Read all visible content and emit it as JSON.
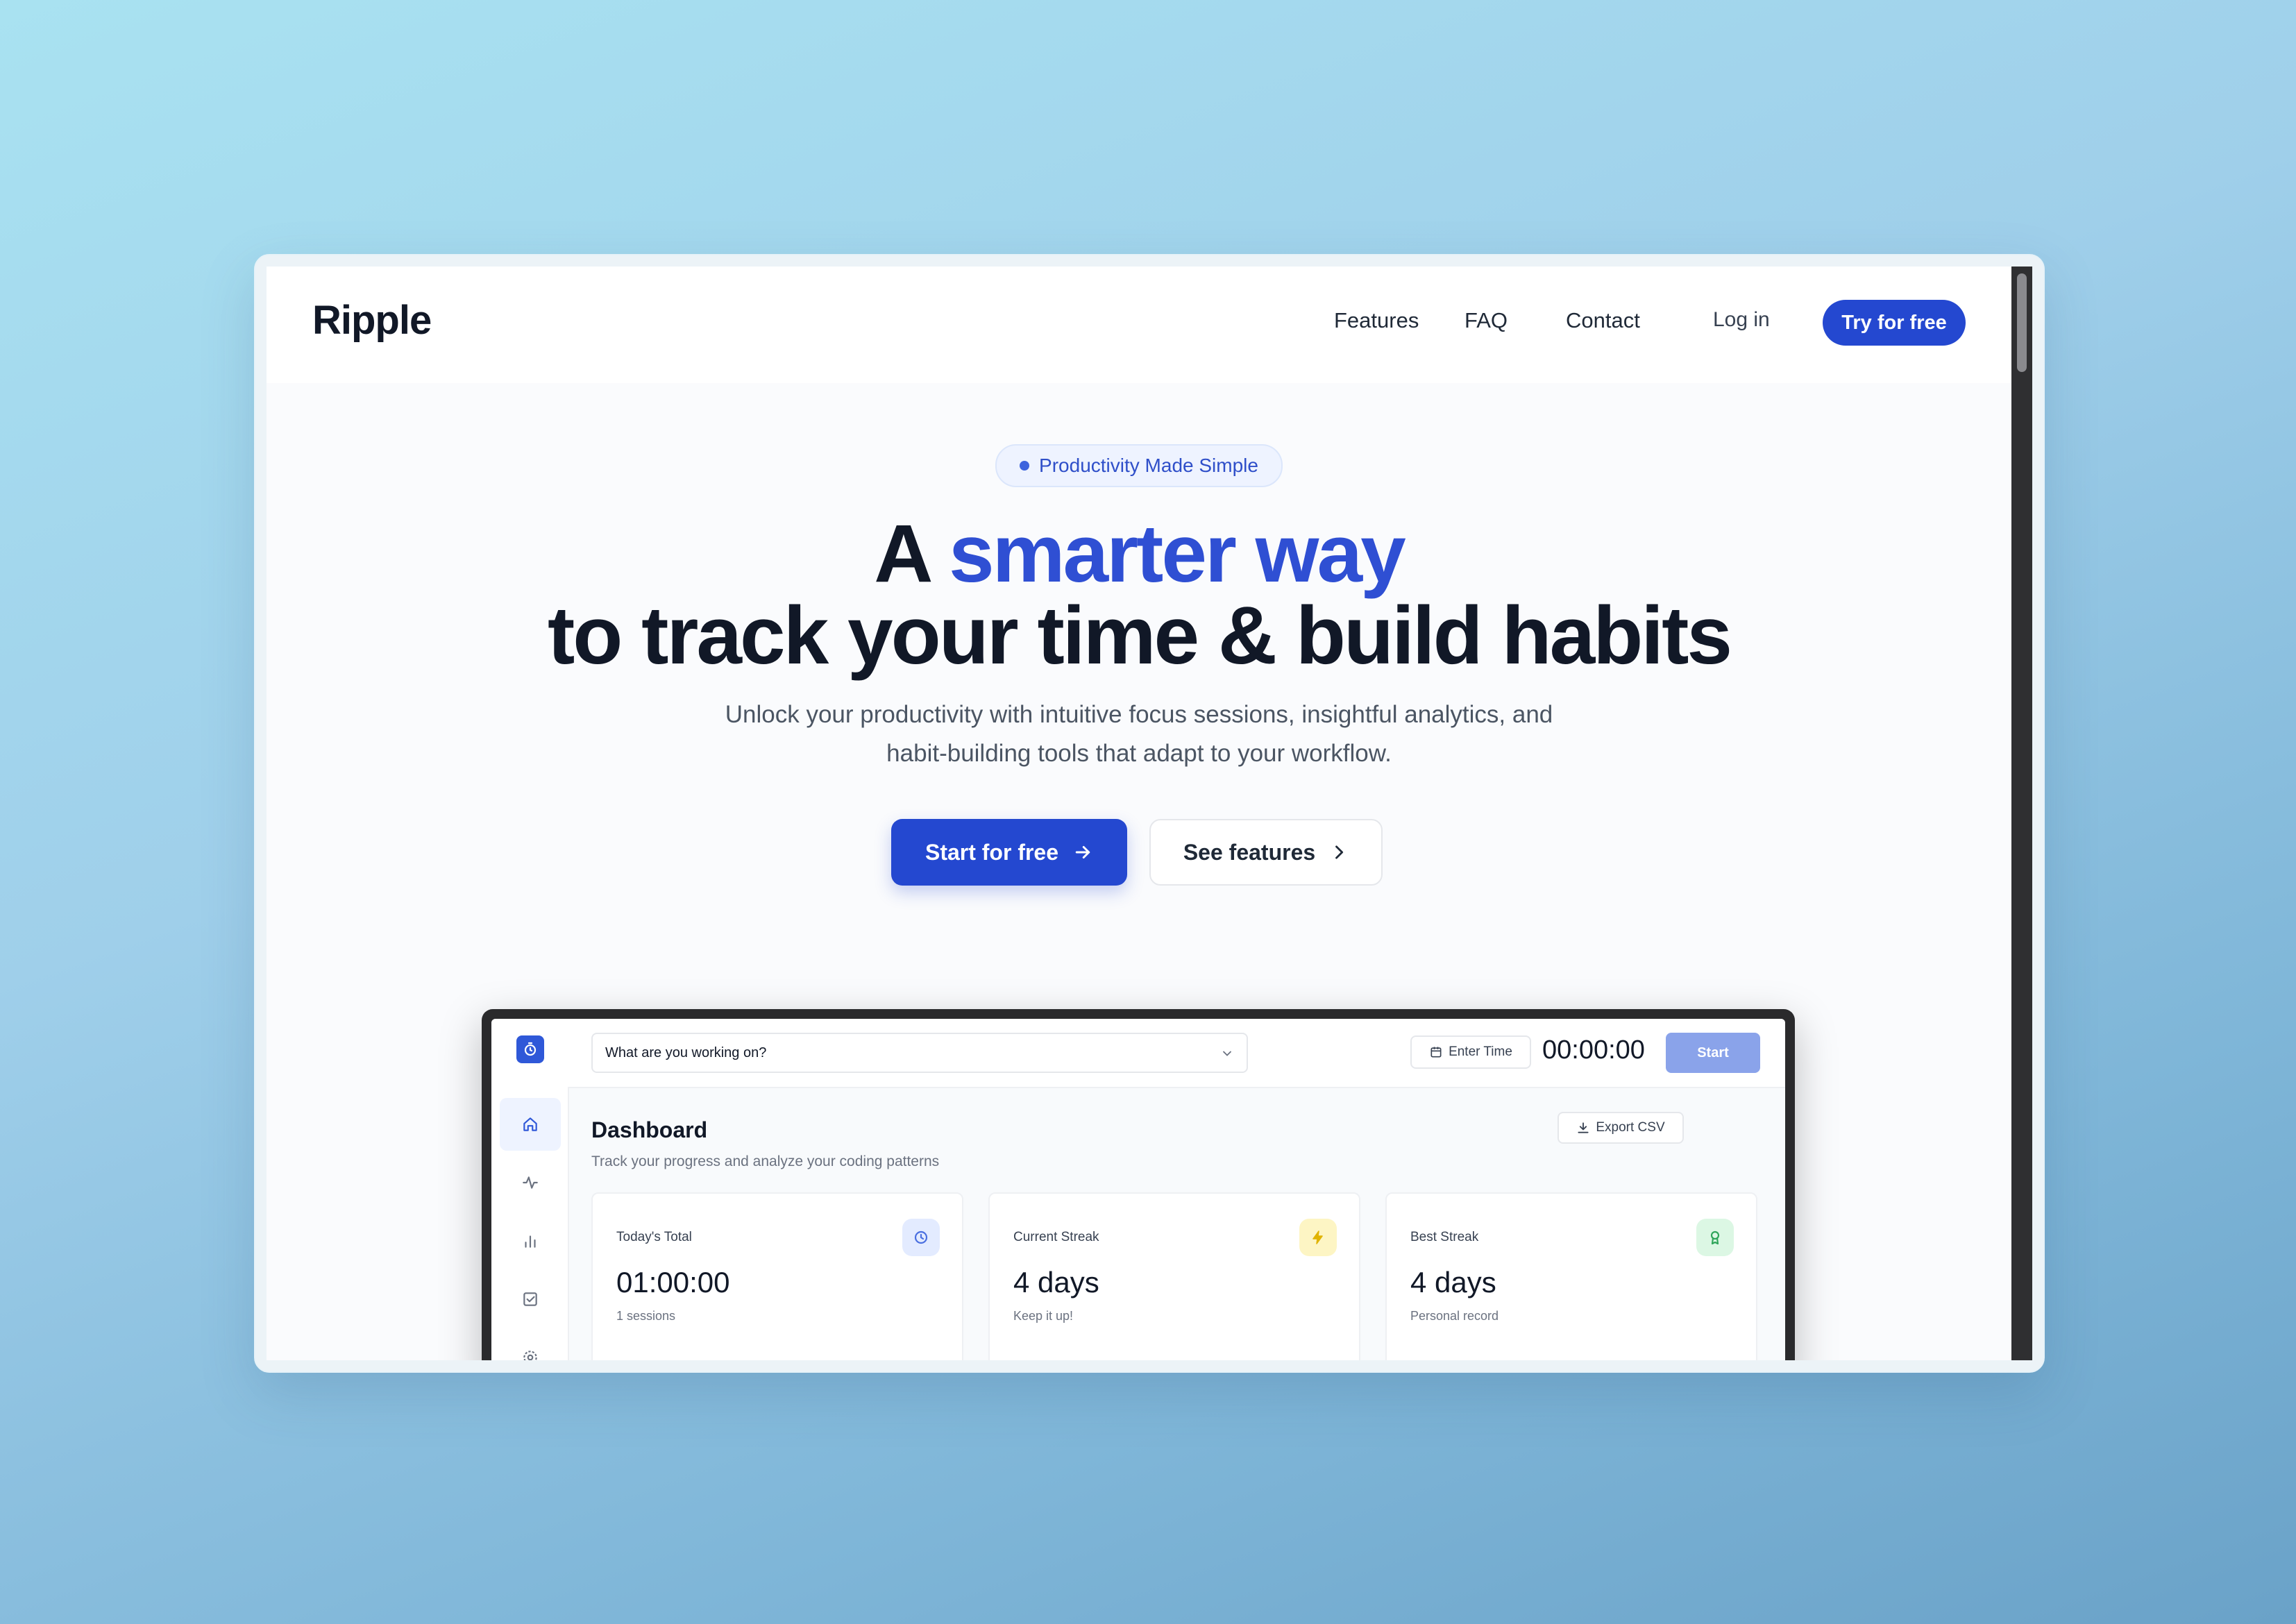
{
  "nav": {
    "logo": "Ripple",
    "links": [
      "Features",
      "FAQ",
      "Contact"
    ],
    "login": "Log in",
    "cta": "Try for free"
  },
  "hero": {
    "badge": "Productivity Made Simple",
    "title_prefix": "A",
    "title_accent": "smarter way",
    "title_line2": "to track your time & build habits",
    "subtitle_line1": "Unlock your productivity with intuitive focus sessions, insightful analytics, and",
    "subtitle_line2": "habit-building tools that adapt to your workflow.",
    "primary_button": "Start for free",
    "secondary_button": "See features"
  },
  "app": {
    "task_placeholder": "What are you working on?",
    "enter_time": "Enter Time",
    "timer": "00:00:00",
    "start": "Start",
    "dashboard": {
      "title": "Dashboard",
      "subtitle": "Track your progress and analyze your coding patterns",
      "export": "Export CSV",
      "cards": [
        {
          "label": "Today's Total",
          "value": "01:00:00",
          "note": "1 sessions",
          "icon": "clock-icon"
        },
        {
          "label": "Current Streak",
          "value": "4 days",
          "note": "Keep it up!",
          "icon": "bolt-icon"
        },
        {
          "label": "Best Streak",
          "value": "4 days",
          "note": "Personal record",
          "icon": "award-icon"
        }
      ]
    },
    "sidebar_icons": [
      "home-icon",
      "activity-icon",
      "bar-chart-icon",
      "checkbox-icon",
      "settings-icon"
    ]
  },
  "colors": {
    "accent": "#2448d0",
    "accent_text": "#2f4fd3",
    "heading": "#111827"
  }
}
